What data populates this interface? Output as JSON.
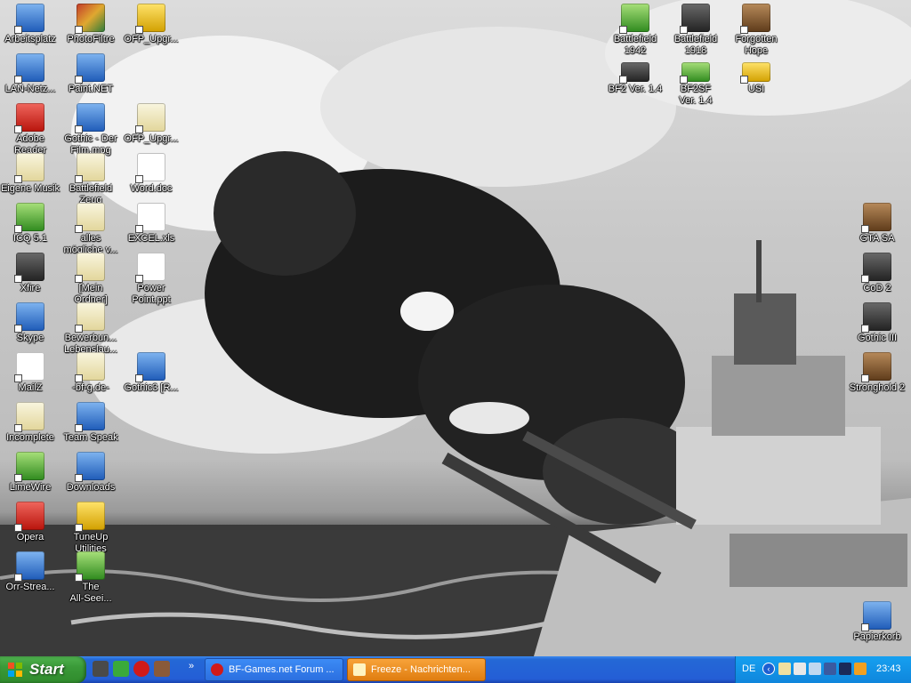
{
  "desktop": {
    "icons": [
      {
        "label": "Arbeitsplatz",
        "icon": "my-computer-icon"
      },
      {
        "label": "LAN-Netz...",
        "icon": "network-icon"
      },
      {
        "label": "Adobe\nReader",
        "icon": "adobe-reader-icon"
      },
      {
        "label": "Eigene Musik",
        "icon": "folder-icon"
      },
      {
        "label": "ICQ 5.1",
        "icon": "icq-icon"
      },
      {
        "label": "Xfire",
        "icon": "xfire-icon"
      },
      {
        "label": "Skype",
        "icon": "skype-icon"
      },
      {
        "label": "MailZ",
        "icon": "mail-icon"
      },
      {
        "label": "Incomplete",
        "icon": "folder-icon"
      },
      {
        "label": "LimeWire",
        "icon": "limewire-icon"
      },
      {
        "label": "Opera",
        "icon": "opera-icon"
      },
      {
        "label": "Orr-Strea...",
        "icon": "stream-icon"
      },
      {
        "label": "PhotoFiltre",
        "icon": "photofiltre-icon"
      },
      {
        "label": "Paint.NET",
        "icon": "paintnet-icon"
      },
      {
        "label": "Gothic - Der\nFilm.mpg",
        "icon": "media-player-icon"
      },
      {
        "label": "Battlefield\nZeug",
        "icon": "folder-icon"
      },
      {
        "label": "alles\nmögliche v...",
        "icon": "folder-icon"
      },
      {
        "label": "[Mein\nOrdner]",
        "icon": "folder-icon"
      },
      {
        "label": "Bewerbun...\nLebenslau...",
        "icon": "folder-icon"
      },
      {
        "label": "-bf-g.de-",
        "icon": "folder-icon"
      },
      {
        "label": "Team Speak",
        "icon": "teamspeak-icon"
      },
      {
        "label": "Downloads",
        "icon": "downloads-checkmark-icon"
      },
      {
        "label": "TuneUp\nUtilities",
        "icon": "tuneup-icon"
      },
      {
        "label": "The\nAll-Seei...",
        "icon": "all-seeing-eye-icon"
      },
      {
        "label": "OFP_Upgr...",
        "icon": "zip-folder-icon"
      },
      {
        "label": "OFP_Upgr...",
        "icon": "folder-icon"
      },
      {
        "label": "Word.doc",
        "icon": "word-document-icon"
      },
      {
        "label": "EXCEL.xls",
        "icon": "excel-document-icon"
      },
      {
        "label": "Power\nPoint.ppt",
        "icon": "powerpoint-document-icon"
      },
      {
        "label": "Gothic3 [R...",
        "icon": "gothic3-icon"
      },
      {
        "label": "Battlefield\n1942",
        "icon": "battlefield-1942-icon"
      },
      {
        "label": "BF2 Ver. 1.4",
        "icon": "battlefield-2-icon"
      },
      {
        "label": "Battlefield\n1918",
        "icon": "battlefield-1918-icon"
      },
      {
        "label": "BF2SF\nVer. 1.4",
        "icon": "bf2sf-icon"
      },
      {
        "label": "Forgotten\nHope",
        "icon": "forgotten-hope-icon"
      },
      {
        "label": "USI",
        "icon": "usi-icon"
      },
      {
        "label": "GTA SA",
        "icon": "gta-sa-icon"
      },
      {
        "label": "CoD 2",
        "icon": "cod2-icon"
      },
      {
        "label": "Gothic III",
        "icon": "gothic-iii-icon"
      },
      {
        "label": "Stronghold 2",
        "icon": "stronghold-2-icon"
      },
      {
        "label": "Papierkorb",
        "icon": "recycle-bin-icon"
      }
    ]
  },
  "taskbar": {
    "start_label": "Start",
    "quick_launch": [
      "winamp-icon",
      "icq-quick-icon",
      "opera-quick-icon",
      "game-quick-icon"
    ],
    "quick_launch_more": "»",
    "tasks": [
      {
        "label": "BF-Games.net Forum ...",
        "icon": "opera-icon",
        "active": false
      },
      {
        "label": "Freeze - Nachrichten...",
        "icon": "message-icon",
        "active": true
      }
    ],
    "tray": {
      "language": "DE",
      "chevron": "‹",
      "icons": [
        "network-tray-icon",
        "messenger-tray-icon",
        "volume-tray-icon",
        "display-tray-icon",
        "antivirus-tray-icon",
        "vlc-tray-icon"
      ],
      "clock": "23:43"
    }
  },
  "colors": {
    "taskbar_blue": "#245ed6",
    "start_green": "#3a9a38",
    "active_task_orange": "#e07d10",
    "tray_blue": "#0f86dc"
  }
}
